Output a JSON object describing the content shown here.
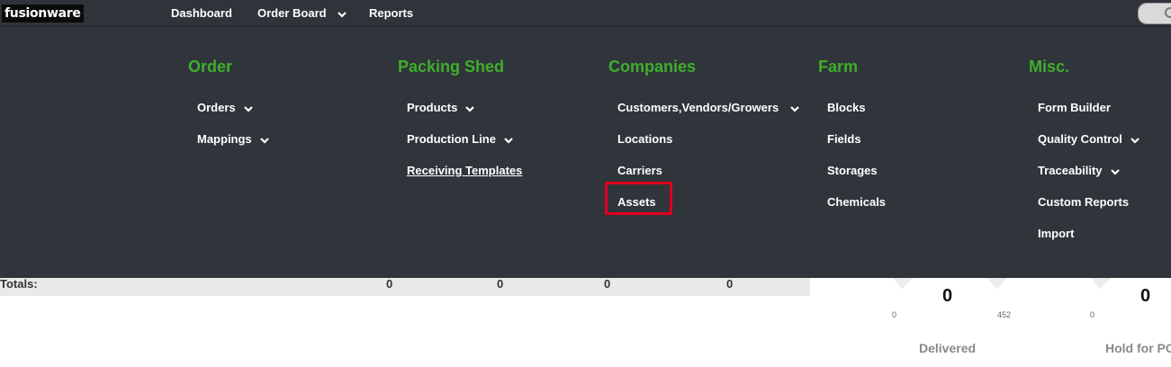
{
  "app": {
    "logo_text": "fusionware"
  },
  "topnav": {
    "items": [
      {
        "label": "Dashboard"
      },
      {
        "label": "Order Board"
      },
      {
        "label": "Reports"
      }
    ]
  },
  "mega_menu": {
    "columns": [
      {
        "title": "Order",
        "items": [
          {
            "label": "Orders"
          },
          {
            "label": "Mappings"
          }
        ]
      },
      {
        "title": "Packing Shed",
        "items": [
          {
            "label": "Products"
          },
          {
            "label": "Production Line"
          },
          {
            "label": "Receiving Templates"
          }
        ]
      },
      {
        "title": "Companies",
        "items": [
          {
            "label": "Customers,Vendors/Growers"
          },
          {
            "label": "Locations"
          },
          {
            "label": "Carriers"
          },
          {
            "label": "Assets"
          }
        ]
      },
      {
        "title": "Farm",
        "items": [
          {
            "label": "Blocks"
          },
          {
            "label": "Fields"
          },
          {
            "label": "Storages"
          },
          {
            "label": "Chemicals"
          }
        ]
      },
      {
        "title": "Misc.",
        "items": [
          {
            "label": "Form Builder"
          },
          {
            "label": "Quality Control"
          },
          {
            "label": "Traceability"
          },
          {
            "label": "Custom Reports"
          },
          {
            "label": "Import"
          }
        ]
      }
    ]
  },
  "totals": {
    "label": "Totals:",
    "values": [
      "0",
      "0",
      "0",
      "0"
    ]
  },
  "gauges": [
    {
      "value": "0",
      "min": "0",
      "max": "452",
      "label": "Delivered"
    },
    {
      "value": "0",
      "min": "0",
      "label": "Hold for PO"
    }
  ],
  "colors": {
    "nav_bg": "#30343a",
    "menu_bg": "#30353b",
    "heading_green": "#3fae2a",
    "highlight_red": "#e0001b"
  }
}
